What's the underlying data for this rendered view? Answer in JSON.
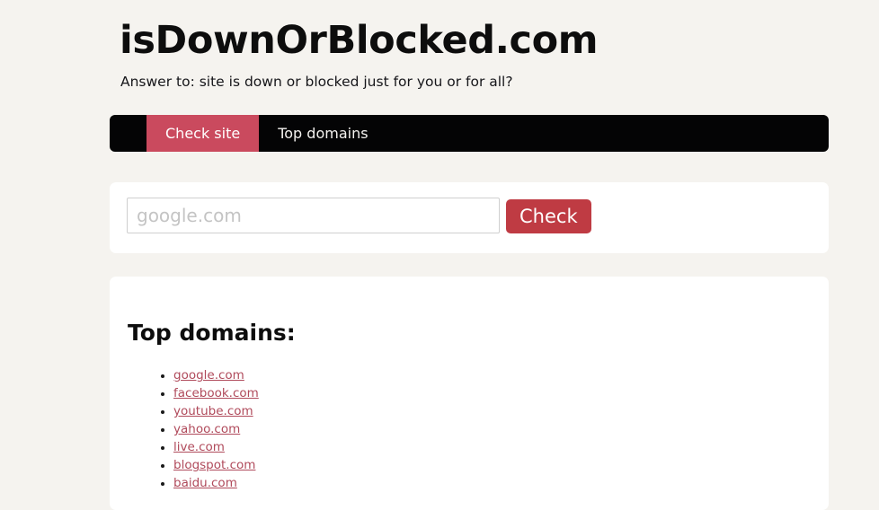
{
  "header": {
    "title": "isDownOrBlocked.com",
    "subtitle": "Answer to: site is down or blocked just for you or for all?"
  },
  "nav": {
    "items": [
      {
        "label": "Check site",
        "active": true
      },
      {
        "label": "Top domains",
        "active": false
      }
    ]
  },
  "search": {
    "value": "",
    "placeholder": "google.com",
    "button_label": "Check"
  },
  "domains": {
    "heading": "Top domains:",
    "items": [
      "google.com",
      "facebook.com",
      "youtube.com",
      "yahoo.com",
      "live.com",
      "blogspot.com",
      "baidu.com"
    ]
  },
  "colors": {
    "page_background": "#f5f3ef",
    "navbar_background": "#040405",
    "active_tab": "#ca4a5e",
    "check_button": "#bf3b43",
    "link": "#b04a5b",
    "card_background": "#ffffff",
    "text": "#0d0d0d"
  }
}
